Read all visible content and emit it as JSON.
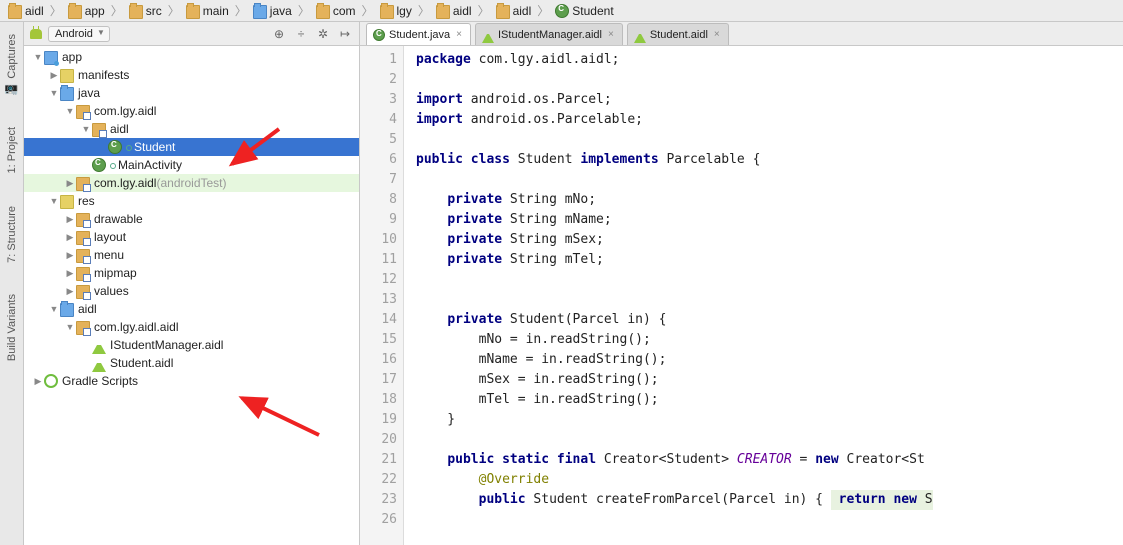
{
  "breadcrumb": [
    {
      "icon": "folder",
      "label": "aidl"
    },
    {
      "icon": "folder",
      "label": "app"
    },
    {
      "icon": "folder",
      "label": "src"
    },
    {
      "icon": "folder",
      "label": "main"
    },
    {
      "icon": "bluefolder",
      "label": "java"
    },
    {
      "icon": "folder",
      "label": "com"
    },
    {
      "icon": "folder",
      "label": "lgy"
    },
    {
      "icon": "folder",
      "label": "aidl"
    },
    {
      "icon": "folder",
      "label": "aidl"
    },
    {
      "icon": "class",
      "label": "Student"
    }
  ],
  "rail": {
    "captures": "Captures",
    "project": "1: Project",
    "structure": "7: Structure",
    "variants": "Build Variants"
  },
  "projHeader": {
    "combo": "Android"
  },
  "tree": [
    {
      "d": 0,
      "a": "▼",
      "i": "mod",
      "t": "app"
    },
    {
      "d": 1,
      "a": "▶",
      "i": "yellow",
      "t": "manifests"
    },
    {
      "d": 1,
      "a": "▼",
      "i": "bluefolder",
      "t": "java"
    },
    {
      "d": 2,
      "a": "▼",
      "i": "pkg",
      "t": "com.lgy.aidl"
    },
    {
      "d": 3,
      "a": "▼",
      "i": "pkg",
      "t": "aidl"
    },
    {
      "d": 4,
      "a": "",
      "i": "class",
      "t": "Student",
      "sel": true,
      "link": true
    },
    {
      "d": 3,
      "a": "",
      "i": "class",
      "t": "MainActivity",
      "link": true
    },
    {
      "d": 2,
      "a": "▶",
      "i": "pkg",
      "t": "com.lgy.aidl",
      "dim": " (androidTest)",
      "hov": true
    },
    {
      "d": 1,
      "a": "▼",
      "i": "yellow",
      "t": "res"
    },
    {
      "d": 2,
      "a": "▶",
      "i": "pkg",
      "t": "drawable"
    },
    {
      "d": 2,
      "a": "▶",
      "i": "pkg",
      "t": "layout"
    },
    {
      "d": 2,
      "a": "▶",
      "i": "pkg",
      "t": "menu"
    },
    {
      "d": 2,
      "a": "▶",
      "i": "pkg",
      "t": "mipmap"
    },
    {
      "d": 2,
      "a": "▶",
      "i": "pkg",
      "t": "values"
    },
    {
      "d": 1,
      "a": "▼",
      "i": "bluefolder",
      "t": "aidl"
    },
    {
      "d": 2,
      "a": "▼",
      "i": "pkg",
      "t": "com.lgy.aidl.aidl"
    },
    {
      "d": 3,
      "a": "",
      "i": "aidl",
      "t": "IStudentManager.aidl"
    },
    {
      "d": 3,
      "a": "",
      "i": "aidl",
      "t": "Student.aidl"
    },
    {
      "d": 0,
      "a": "▶",
      "i": "gradle",
      "t": "Gradle Scripts"
    }
  ],
  "tabs": [
    {
      "icon": "class",
      "label": "Student.java",
      "active": true
    },
    {
      "icon": "aidl",
      "label": "IStudentManager.aidl"
    },
    {
      "icon": "aidl",
      "label": "Student.aidl"
    }
  ],
  "code": {
    "lines": [
      {
        "n": 1,
        "h": "<span class='kw'>package</span> com.lgy.aidl.aidl;"
      },
      {
        "n": 2,
        "h": ""
      },
      {
        "n": 3,
        "h": "<span class='kw'>import</span> android.os.Parcel;"
      },
      {
        "n": 4,
        "h": "<span class='kw'>import</span> android.os.Parcelable;"
      },
      {
        "n": 5,
        "h": ""
      },
      {
        "n": 6,
        "h": "<span class='kw'>public class</span> Student <span class='kw'>implements</span> Parcelable {"
      },
      {
        "n": 7,
        "h": ""
      },
      {
        "n": 8,
        "h": "    <span class='kw'>private</span> String mNo;"
      },
      {
        "n": 9,
        "h": "    <span class='kw'>private</span> String mName;"
      },
      {
        "n": 10,
        "h": "    <span class='kw'>private</span> String mSex;"
      },
      {
        "n": 11,
        "h": "    <span class='kw'>private</span> String mTel;"
      },
      {
        "n": 12,
        "h": ""
      },
      {
        "n": 13,
        "h": ""
      },
      {
        "n": 14,
        "h": "    <span class='kw'>private</span> Student(Parcel in) {"
      },
      {
        "n": 15,
        "h": "        mNo = in.readString();"
      },
      {
        "n": 16,
        "h": "        mName = in.readString();"
      },
      {
        "n": 17,
        "h": "        mSex = in.readString();"
      },
      {
        "n": 18,
        "h": "        mTel = in.readString();"
      },
      {
        "n": 19,
        "h": "    }"
      },
      {
        "n": 20,
        "h": ""
      },
      {
        "n": 21,
        "h": "    <span class='kw'>public static final</span> Creator&lt;Student&gt; <span class='cre'>CREATOR</span> = <span class='kw'>new</span> Creator&lt;St"
      },
      {
        "n": 22,
        "h": "        <span class='ann'>@Override</span>"
      },
      {
        "n": 23,
        "h": "        <span class='kw'>public</span> Student createFromParcel(Parcel in) { <span class='bg'> <span class='kw'>return new</span> S</span>"
      },
      {
        "n": 26,
        "h": ""
      }
    ]
  }
}
